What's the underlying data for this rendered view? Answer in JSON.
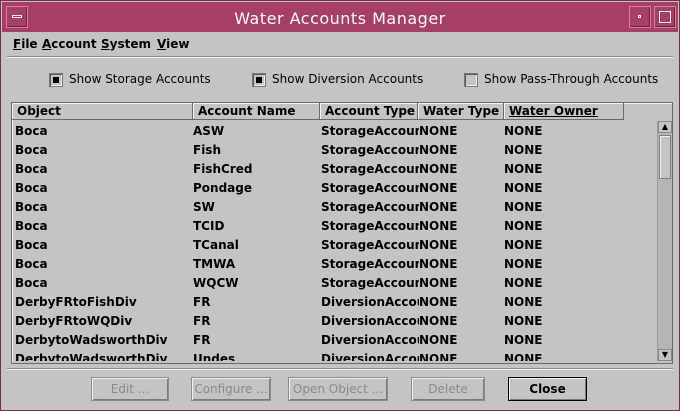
{
  "window": {
    "title": "Water Accounts Manager"
  },
  "menubar": [
    {
      "mnemonic": "F",
      "rest": "ile"
    },
    {
      "mnemonic": "A",
      "rest": "ccount"
    },
    {
      "mnemonic": "S",
      "rest": "ystem"
    },
    {
      "mnemonic": "V",
      "rest": "iew"
    }
  ],
  "filters": {
    "storage": {
      "label": "Show Storage Accounts",
      "checked": true
    },
    "diversion": {
      "label": "Show Diversion Accounts",
      "checked": true
    },
    "passthrough": {
      "label": "Show Pass-Through Accounts",
      "checked": false
    }
  },
  "table": {
    "columns": [
      "Object",
      "Account Name",
      "Account Type",
      "Water Type",
      "Water Owner"
    ],
    "sorted_column": "Water Owner",
    "rows": [
      [
        "Boca",
        "ASW",
        "StorageAccount",
        "NONE",
        "NONE"
      ],
      [
        "Boca",
        "Fish",
        "StorageAccount",
        "NONE",
        "NONE"
      ],
      [
        "Boca",
        "FishCred",
        "StorageAccount",
        "NONE",
        "NONE"
      ],
      [
        "Boca",
        "Pondage",
        "StorageAccount",
        "NONE",
        "NONE"
      ],
      [
        "Boca",
        "SW",
        "StorageAccount",
        "NONE",
        "NONE"
      ],
      [
        "Boca",
        "TCID",
        "StorageAccount",
        "NONE",
        "NONE"
      ],
      [
        "Boca",
        "TCanal",
        "StorageAccount",
        "NONE",
        "NONE"
      ],
      [
        "Boca",
        "TMWA",
        "StorageAccount",
        "NONE",
        "NONE"
      ],
      [
        "Boca",
        "WQCW",
        "StorageAccount",
        "NONE",
        "NONE"
      ],
      [
        "DerbyFRtoFishDiv",
        "FR",
        "DiversionAccount",
        "NONE",
        "NONE"
      ],
      [
        "DerbyFRtoWQDiv",
        "FR",
        "DiversionAccount",
        "NONE",
        "NONE"
      ],
      [
        "DerbytoWadsworthDiv",
        "FR",
        "DiversionAccount",
        "NONE",
        "NONE"
      ],
      [
        "DerbytoWadsworthDiv",
        "Undes",
        "DiversionAccount",
        "NONE",
        "NONE"
      ]
    ]
  },
  "buttons": {
    "edit": "Edit ...",
    "configure": "Configure ...",
    "open_object": "Open Object ...",
    "delete": "Delete",
    "close": "Close"
  },
  "colors": {
    "titlebar": "#a63e68",
    "background": "#c4c4c4"
  },
  "icons": {
    "window_menu": "window-menu-icon",
    "minimize": "minimize-icon",
    "maximize": "maximize-icon",
    "scroll_up": "scroll-up-arrow-icon",
    "scroll_down": "scroll-down-arrow-icon"
  }
}
